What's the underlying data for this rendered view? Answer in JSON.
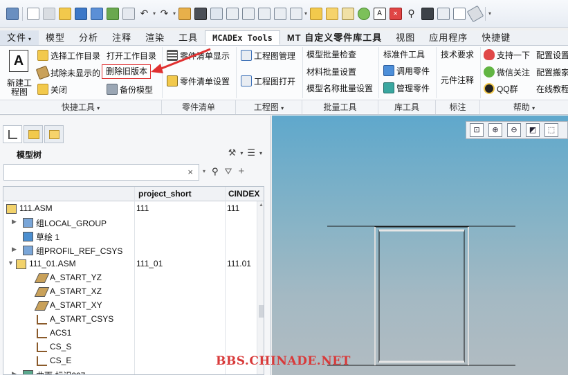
{
  "ribbon_tabs": [
    {
      "label": "文件",
      "caret": "▾"
    },
    {
      "label": "模型"
    },
    {
      "label": "分析"
    },
    {
      "label": "注释"
    },
    {
      "label": "渲染"
    },
    {
      "label": "工具"
    },
    {
      "label": "MCADEx Tools"
    },
    {
      "label": "MT 自定义零件库工具"
    },
    {
      "label": "视图"
    },
    {
      "label": "应用程序"
    },
    {
      "label": "快捷键"
    }
  ],
  "quick_tools": {
    "new_drawing": "新建工程图",
    "select_dir": "选择工作目录",
    "open_dir": "打开工作目录",
    "erase_hidden": "拭除未显示的",
    "delete_old": "删除旧版本",
    "close": "关闭",
    "backup": "备份模型"
  },
  "parts_list": {
    "show": "零件清单显示",
    "settings": "零件清单设置"
  },
  "drawing": {
    "manage": "工程图管理",
    "open": "工程图打开"
  },
  "batch": {
    "model_check": "模型批量检查",
    "material": "材料批量设置",
    "name": "模型名称批量设置"
  },
  "library": {
    "std_tools": "标准件工具",
    "call_part": "调用零件",
    "manage_part": "管理零件"
  },
  "annotation": {
    "tech_req": "技术要求",
    "elem_note": "元件注释"
  },
  "help": {
    "support": "支持一下",
    "wechat": "微信关注",
    "qq": "QQ群",
    "config": "配置设置",
    "config_move": "配置搬家",
    "online": "在线教程"
  },
  "groups": [
    {
      "label": "快捷工具",
      "caret": "▾"
    },
    {
      "label": "零件清单",
      "caret": ""
    },
    {
      "label": "工程图",
      "caret": "▾"
    },
    {
      "label": "批量工具",
      "caret": ""
    },
    {
      "label": "库工具",
      "caret": ""
    },
    {
      "label": "标注",
      "caret": ""
    },
    {
      "label": "帮助",
      "caret": "▾"
    }
  ],
  "tree": {
    "title": "模型树",
    "clear_icon": "×",
    "columns": [
      "project_short",
      "CINDEX"
    ],
    "rows": [
      {
        "name": "111.ASM",
        "project_short": "111",
        "cindex": "111",
        "icon": "assembly-icon",
        "expander": ""
      },
      {
        "name": "组LOCAL_GROUP",
        "project_short": "",
        "cindex": "",
        "icon": "group-icon",
        "expander": "▶"
      },
      {
        "name": "草绘 1",
        "project_short": "",
        "cindex": "",
        "icon": "sketch-icon",
        "expander": ""
      },
      {
        "name": "组PROFIL_REF_CSYS",
        "project_short": "",
        "cindex": "",
        "icon": "group-icon",
        "expander": "▶"
      },
      {
        "name": "111_01.ASM",
        "project_short": "111_01",
        "cindex": "111.01",
        "icon": "assembly-icon",
        "expander": "▼"
      },
      {
        "name": "A_START_YZ",
        "project_short": "",
        "cindex": "",
        "icon": "datum-plane-icon",
        "expander": ""
      },
      {
        "name": "A_START_XZ",
        "project_short": "",
        "cindex": "",
        "icon": "datum-plane-icon",
        "expander": ""
      },
      {
        "name": "A_START_XY",
        "project_short": "",
        "cindex": "",
        "icon": "datum-plane-icon",
        "expander": ""
      },
      {
        "name": "A_START_CSYS",
        "project_short": "",
        "cindex": "",
        "icon": "csys-icon",
        "expander": ""
      },
      {
        "name": "ACS1",
        "project_short": "",
        "cindex": "",
        "icon": "csys-icon",
        "expander": ""
      },
      {
        "name": "CS_S",
        "project_short": "",
        "cindex": "",
        "icon": "csys-icon",
        "expander": ""
      },
      {
        "name": "CS_E",
        "project_short": "",
        "cindex": "",
        "icon": "csys-icon",
        "expander": ""
      },
      {
        "name": "曲面 标识207",
        "project_short": "",
        "cindex": "",
        "icon": "surface-icon",
        "expander": "▶"
      }
    ]
  },
  "watermark": "BBS.CHINADE.NET",
  "colors": {
    "accent_red": "#e03030",
    "viewport_top": "#5fa8cc",
    "viewport_bottom": "#b2bcc2"
  }
}
